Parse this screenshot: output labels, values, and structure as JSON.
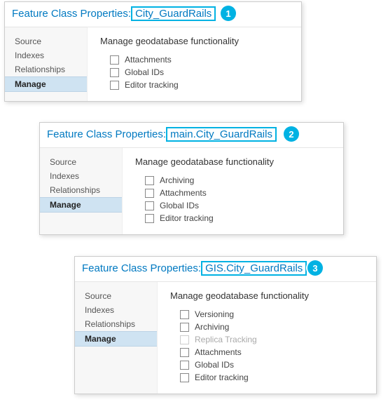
{
  "common": {
    "title_prefix": "Feature Class Properties:",
    "panel_title": "Manage geodatabase functionality",
    "sidebar": {
      "source": "Source",
      "indexes": "Indexes",
      "relationships": "Relationships",
      "manage": "Manage"
    },
    "options": {
      "versioning": "Versioning",
      "archiving": "Archiving",
      "replica": "Replica Tracking",
      "attachments": "Attachments",
      "globalids": "Global IDs",
      "editor": "Editor tracking"
    }
  },
  "windows": {
    "w1": {
      "name": "City_GuardRails",
      "marker": "1"
    },
    "w2": {
      "name": "main.City_GuardRails",
      "marker": "2"
    },
    "w3": {
      "name": "GIS.City_GuardRails",
      "marker": "3"
    }
  }
}
